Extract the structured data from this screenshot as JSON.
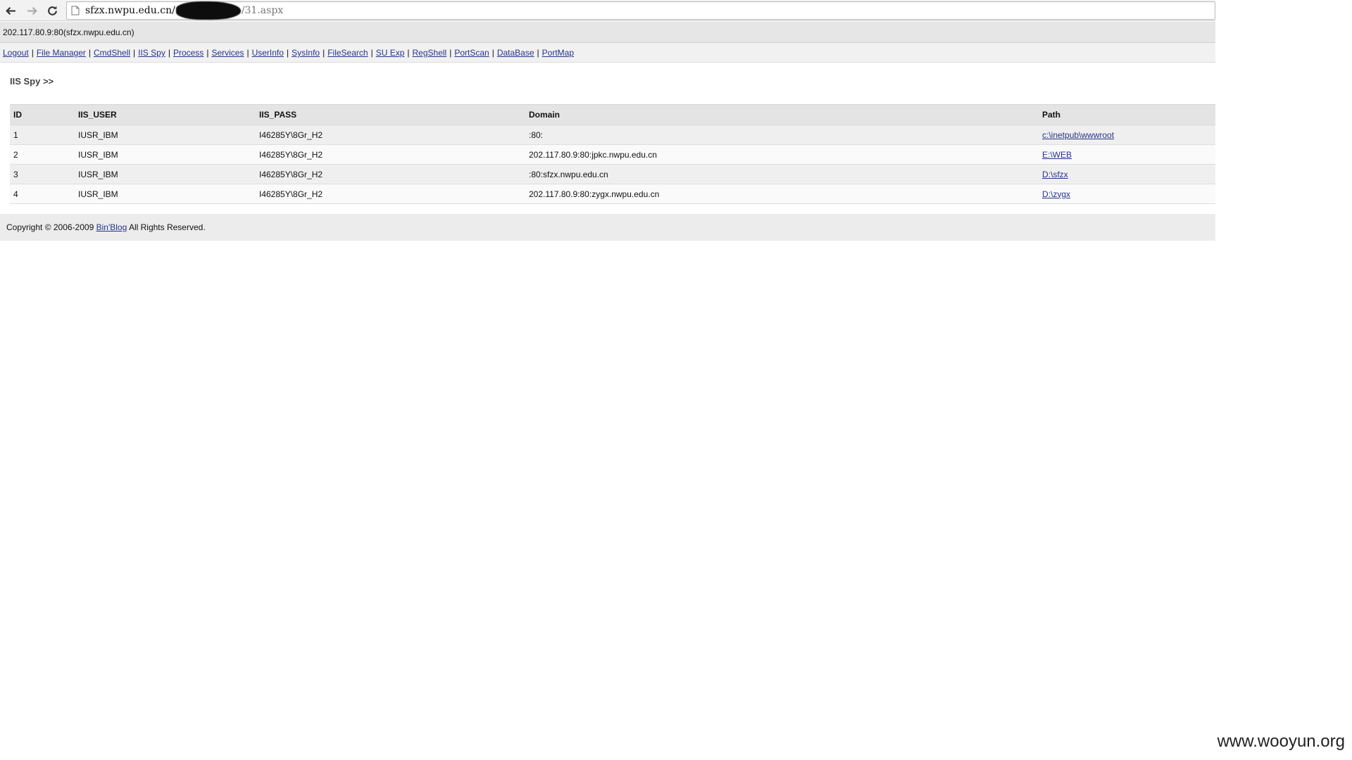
{
  "browser": {
    "url_host": "sfzx.nwpu.edu.cn/",
    "url_path": "/31.aspx"
  },
  "host_line": "202.117.80.9:80(sfzx.nwpu.edu.cn)",
  "menu": {
    "items": [
      "Logout",
      "File Manager",
      "CmdShell",
      "IIS Spy",
      "Process",
      "Services",
      "UserInfo",
      "SysInfo",
      "FileSearch",
      "SU Exp",
      "RegShell",
      "PortScan",
      "DataBase",
      "PortMap"
    ]
  },
  "section_title": "IIS Spy >>",
  "table": {
    "headers": [
      "ID",
      "IIS_USER",
      "IIS_PASS",
      "Domain",
      "Path"
    ],
    "rows": [
      {
        "id": "1",
        "user": "IUSR_IBM",
        "pass": "I46285Y\\8Gr_H2",
        "domain": ":80:",
        "path": "c:\\inetpub\\wwwroot"
      },
      {
        "id": "2",
        "user": "IUSR_IBM",
        "pass": "I46285Y\\8Gr_H2",
        "domain": "202.117.80.9:80:jpkc.nwpu.edu.cn",
        "path": "E:\\WEB"
      },
      {
        "id": "3",
        "user": "IUSR_IBM",
        "pass": "I46285Y\\8Gr_H2",
        "domain": ":80:sfzx.nwpu.edu.cn",
        "path": "D:\\sfzx"
      },
      {
        "id": "4",
        "user": "IUSR_IBM",
        "pass": "I46285Y\\8Gr_H2",
        "domain": "202.117.80.9:80:zygx.nwpu.edu.cn",
        "path": "D:\\zygx"
      }
    ]
  },
  "footer": {
    "prefix": "Copyright © 2006-2009",
    "link": "Bin'Blog",
    "suffix": "All Rights Reserved."
  },
  "watermark": "www.wooyun.org"
}
